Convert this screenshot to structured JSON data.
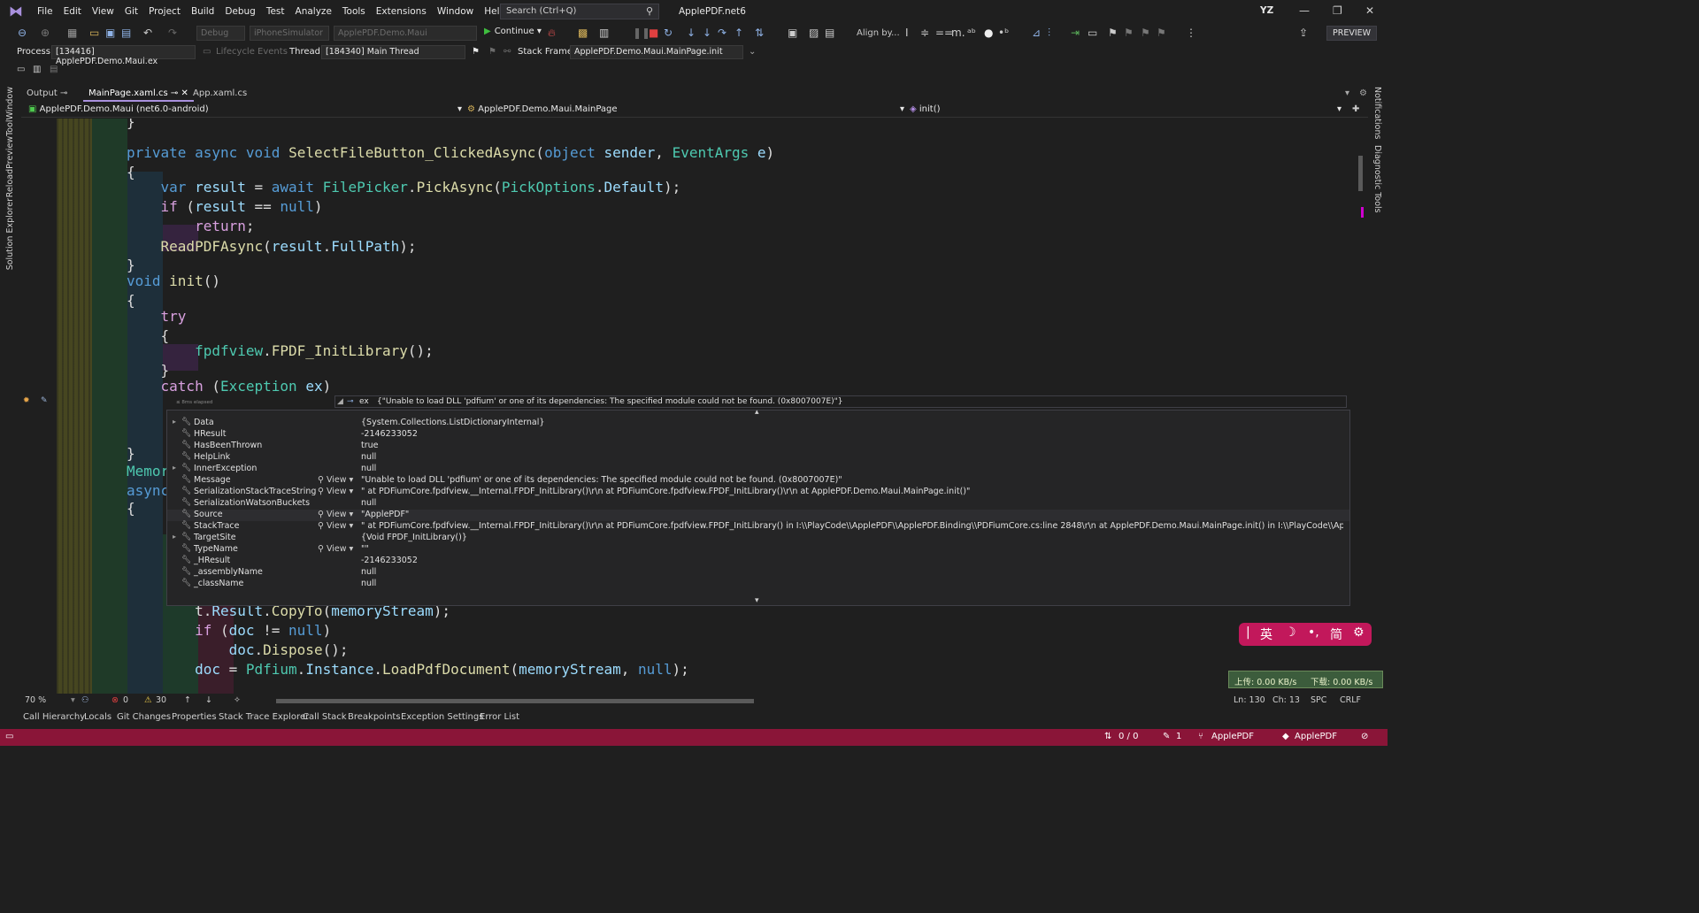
{
  "titlebar": {
    "menu": [
      "File",
      "Edit",
      "View",
      "Git",
      "Project",
      "Build",
      "Debug",
      "Test",
      "Analyze",
      "Tools",
      "Extensions",
      "Window",
      "Help"
    ],
    "search_placeholder": "Search (Ctrl+Q)",
    "solution_name": "ApplePDF.net6",
    "user_initials": "YZ"
  },
  "toolbar": {
    "config": "Debug",
    "platform": "iPhoneSimulator",
    "startup_project": "ApplePDF.Demo.Maui",
    "continue_label": "Continue",
    "align_by_label": "Align by...",
    "preview_label": "PREVIEW"
  },
  "debug_bar": {
    "process_label": "Process:",
    "process_value": "[134416] ApplePDF.Demo.Maui.ex",
    "lifecycle_label": "Lifecycle Events",
    "thread_label": "Thread:",
    "thread_value": "[184340] Main Thread",
    "stack_frame_label": "Stack Frame:",
    "stack_frame_value": "ApplePDF.Demo.Maui.MainPage.init"
  },
  "side_rails": {
    "left": [
      "ReloadPreviewToolWindow",
      "Solution Explorer"
    ],
    "right": [
      "Notifications",
      "Diagnostic Tools"
    ]
  },
  "doc_tabs": [
    {
      "label": "Output"
    },
    {
      "label": "MainPage.xaml.cs"
    },
    {
      "label": "App.xaml.cs"
    }
  ],
  "navbar": {
    "project": "ApplePDF.Demo.Maui (net6.0-android)",
    "type": "ApplePDF.Demo.Maui.MainPage",
    "member": "init()"
  },
  "datatip": {
    "header_name": "ex",
    "header_value": "{\"Unable to load DLL 'pdfium' or one of its dependencies: The specified module could not be found. (0x8007007E)\"}",
    "elapsed": "≤ 8ms elapsed",
    "view_label": "View",
    "rows": [
      {
        "name": "Data",
        "value": "{System.Collections.ListDictionaryInternal}",
        "expand": true,
        "view": false
      },
      {
        "name": "HResult",
        "value": "-2146233052",
        "expand": false,
        "view": false
      },
      {
        "name": "HasBeenThrown",
        "value": "true",
        "expand": false,
        "view": false
      },
      {
        "name": "HelpLink",
        "value": "null",
        "expand": false,
        "view": false
      },
      {
        "name": "InnerException",
        "value": "null",
        "expand": true,
        "view": false
      },
      {
        "name": "Message",
        "value": "\"Unable to load DLL 'pdfium' or one of its dependencies: The specified module could not be found. (0x8007007E)\"",
        "expand": false,
        "view": true
      },
      {
        "name": "SerializationStackTraceString",
        "value": "\"   at PDFiumCore.fpdfview.__Internal.FPDF_InitLibrary()\\r\\n   at PDFiumCore.fpdfview.FPDF_InitLibrary()\\r\\n   at ApplePDF.Demo.Maui.MainPage.init()\"",
        "expand": false,
        "view": true
      },
      {
        "name": "SerializationWatsonBuckets",
        "value": "null",
        "expand": false,
        "view": false
      },
      {
        "name": "Source",
        "value": "\"ApplePDF\"",
        "expand": false,
        "view": true
      },
      {
        "name": "StackTrace",
        "value": "\"   at PDFiumCore.fpdfview.__Internal.FPDF_InitLibrary()\\r\\n   at PDFiumCore.fpdfview.FPDF_InitLibrary() in I:\\\\PlayCode\\\\ApplePDF\\\\ApplePDF.Binding\\\\PDFiumCore.cs:line 2848\\r\\n   at ApplePDF.Demo.Maui.MainPage.init() in I:\\\\PlayCode\\\\ApplePDF\\\\Appl...",
        "expand": false,
        "view": true
      },
      {
        "name": "TargetSite",
        "value": "{Void FPDF_InitLibrary()}",
        "expand": true,
        "view": false
      },
      {
        "name": "TypeName",
        "value": "\"\"",
        "expand": false,
        "view": true
      },
      {
        "name": "_HResult",
        "value": "-2146233052",
        "expand": false,
        "view": false
      },
      {
        "name": "_assemblyName",
        "value": "null",
        "expand": false,
        "view": false
      },
      {
        "name": "_className",
        "value": "null",
        "expand": false,
        "view": false
      }
    ]
  },
  "editor_status": {
    "zoom": "70 %",
    "errors": "0",
    "warnings": "30",
    "line": "Ln: 130",
    "col": "Ch: 13",
    "spc": "SPC",
    "crlf": "CRLF"
  },
  "bottom_tabs": [
    "Call Hierarchy",
    "Locals",
    "Git Changes",
    "Properties",
    "Stack Trace Explorer",
    "Call Stack",
    "Breakpoints",
    "Exception Settings",
    "Error List"
  ],
  "statusbar": {
    "changes": "0 / 0",
    "pencil_count": "1",
    "branch": "ApplePDF",
    "repo": "ApplePDF"
  },
  "ime": {
    "lang": "英",
    "moon": "☽",
    "punct": "•,",
    "simp": "简"
  },
  "netspeed": {
    "up": "上传: 0.00 KB/s",
    "down": "下载: 0.00 KB/s"
  }
}
